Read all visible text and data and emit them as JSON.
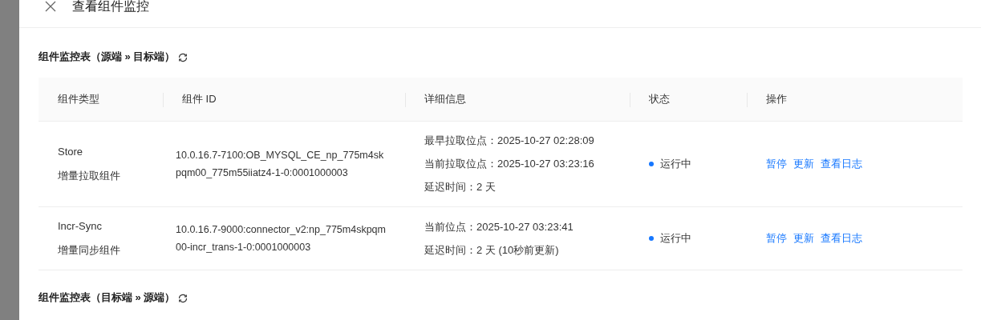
{
  "drawer": {
    "title": "查看组件监控"
  },
  "sections": [
    {
      "title": "组件监控表（源端 » 目标端）",
      "table": {
        "columns": [
          "组件类型",
          "组件 ID",
          "详细信息",
          "状态",
          "操作"
        ],
        "rows": [
          {
            "name": "Store",
            "type": "增量拉取组件",
            "id": "10.0.16.7-7100:OB_MYSQL_CE_np_775m4skpqm00_775m55iiatz4-1-0:0001000003",
            "details": [
              "最早拉取位点：2025-10-27 02:28:09",
              "当前拉取位点：2025-10-27 03:23:16",
              "延迟时间：2 天"
            ],
            "status": {
              "label": "运行中",
              "color": "#1677ff"
            },
            "actions": [
              "暂停",
              "更新",
              "查看日志"
            ]
          },
          {
            "name": "Incr-Sync",
            "type": "增量同步组件",
            "id": "10.0.16.7-9000:connector_v2:np_775m4skpqm00-incr_trans-1-0:0001000003",
            "details": [
              "当前位点：2025-10-27 03:23:41",
              "延迟时间：2 天 (10秒前更新)"
            ],
            "status": {
              "label": "运行中",
              "color": "#1677ff"
            },
            "actions": [
              "暂停",
              "更新",
              "查看日志"
            ]
          }
        ]
      }
    },
    {
      "title": "组件监控表（目标端 » 源端）"
    }
  ]
}
